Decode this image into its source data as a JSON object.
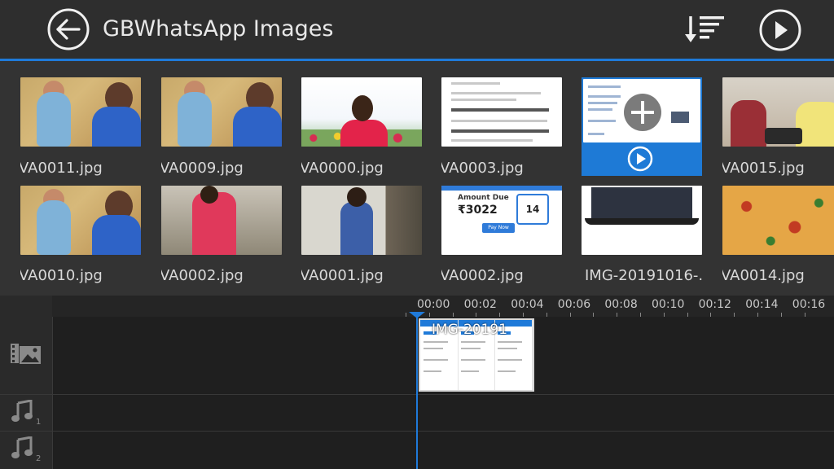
{
  "header": {
    "title": "GBWhatsApp Images",
    "icons": [
      "back-arrow-icon",
      "sort-icon",
      "play-icon"
    ]
  },
  "grid": {
    "row1": [
      {
        "label": "VA0011.jpg"
      },
      {
        "label": "VA0009.jpg"
      },
      {
        "label": "VA0000.jpg"
      },
      {
        "label": "VA0003.jpg"
      },
      {
        "label": ""
      },
      {
        "label": "VA0015.jpg"
      }
    ],
    "row2": [
      {
        "label": "VA0010.jpg"
      },
      {
        "label": "VA0002.jpg"
      },
      {
        "label": "VA0001.jpg"
      },
      {
        "label": "VA0002.jpg"
      },
      {
        "label": "IMG-20191016-.."
      },
      {
        "label": "VA0014.jpg"
      }
    ],
    "doc_snippets": {
      "amount_due": "Amount Due",
      "rupee": "₹3022",
      "cal_day": "14",
      "pay_now": "Pay Now"
    }
  },
  "timeline": {
    "ticks": [
      "00:00",
      "00:02",
      "00:04",
      "00:06",
      "00:08",
      "00:10",
      "00:12",
      "00:14",
      "00:16"
    ],
    "clip_label": "IMG-20191",
    "tracks": [
      {
        "icon": "video-image-track-icon"
      },
      {
        "icon": "music-track-1-icon",
        "number": "1"
      },
      {
        "icon": "music-track-2-icon",
        "number": "2"
      }
    ]
  },
  "colors": {
    "accent": "#1f7ad9",
    "header_bg": "#2e2e2e",
    "grid_bg": "#333333",
    "timeline_bg": "#1f1f1f"
  }
}
